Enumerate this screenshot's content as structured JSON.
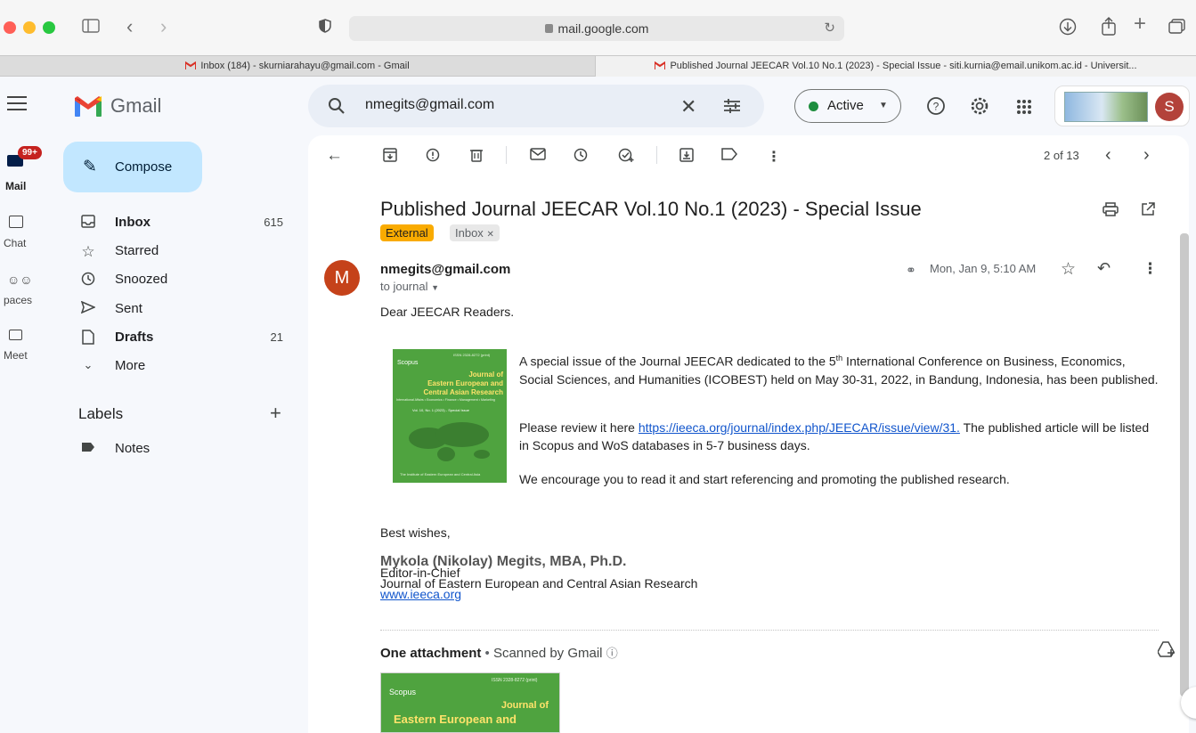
{
  "browser": {
    "url": "mail.google.com",
    "tabs": [
      {
        "label": "Inbox (184) - skurniarahayu@gmail.com - Gmail",
        "active": false
      },
      {
        "label": "Published Journal JEECAR Vol.10 No.1 (2023) - Special Issue - siti.kurnia@email.unikom.ac.id - Universit...",
        "active": true
      }
    ]
  },
  "rail": {
    "badge": "99+",
    "items": [
      "Mail",
      "Chat",
      "paces",
      "Meet"
    ]
  },
  "gmail": {
    "logo_text": "Gmail",
    "search_value": "nmegits@gmail.com",
    "status_label": "Active",
    "status_color": "#1e8e3e",
    "account_initial": "S",
    "compose_label": "Compose",
    "nav": [
      {
        "icon": "inbox-icon",
        "label": "Inbox",
        "count": "615",
        "bold": true
      },
      {
        "icon": "star-icon",
        "label": "Starred",
        "count": "",
        "bold": false
      },
      {
        "icon": "clock-icon",
        "label": "Snoozed",
        "count": "",
        "bold": false
      },
      {
        "icon": "send-icon",
        "label": "Sent",
        "count": "",
        "bold": false
      },
      {
        "icon": "draft-icon",
        "label": "Drafts",
        "count": "21",
        "bold": true
      },
      {
        "icon": "chevron-down-icon",
        "label": "More",
        "count": "",
        "bold": false
      }
    ],
    "labels_heading": "Labels",
    "labels": [
      "Notes"
    ]
  },
  "message": {
    "pager": "2 of 13",
    "subject": "Published Journal JEECAR Vol.10 No.1 (2023) - Special Issue",
    "chip_external": "External",
    "chip_inbox": "Inbox",
    "sender": "nmegits@gmail.com",
    "avatar_letter": "M",
    "to_line": "to journal",
    "date": "Mon, Jan 9, 5:10 AM",
    "greeting": "Dear JEECAR Readers.",
    "p1_a": "A special issue of the Journal JEECAR dedicated to the 5",
    "p1_sup": "th",
    "p1_b": " International Conference on Business, Economics, Social Sciences, and Humanities (ICOBEST) held on May 30-31, 2022, in Bandung, Indonesia, has been published.",
    "p2_a": "Please review it here ",
    "p2_link": "https://ieeca.org/journal/index.php/JEECAR/issue/view/31.",
    "p2_b": " The published article will be listed in Scopus and WoS databases in 5-7 business days.",
    "p3": "We encourage you to read it and start referencing and promoting the published research.",
    "closing": "Best wishes,",
    "sig_name": "Mykola (Nikolay) Megits, MBA, Ph.D.",
    "sig_title": "Editor-in-Chief",
    "sig_org": "Journal of Eastern European and Central Asian Research",
    "sig_web": "www.ieeca.org",
    "attach_heading": "One attachment",
    "attach_scanned": "Scanned by Gmail"
  },
  "cover": {
    "scopus": "Scopus",
    "issn": "ISSN 2328-8272 (print)",
    "title_lines": [
      "Journal of",
      "Eastern European and",
      "Central Asian Research"
    ],
    "sub": "International Affairs • Economics • Finance • Management • Marketing",
    "vol": "Vol. 10, No. 1 (2023) - Special Issue",
    "footer": "The Institute of Eastern European and Central Asia"
  }
}
